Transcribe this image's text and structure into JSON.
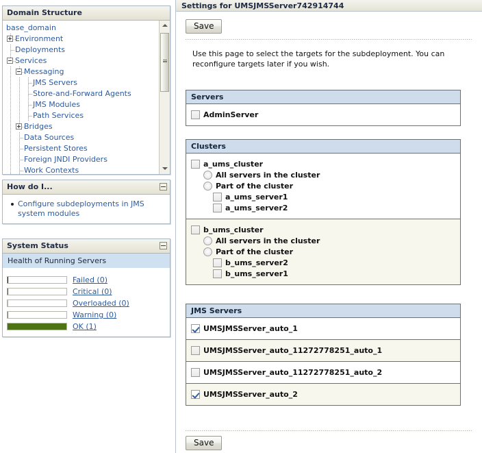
{
  "left": {
    "domain_structure": {
      "title": "Domain Structure",
      "root": "base_domain",
      "nodes": [
        {
          "label": "Environment",
          "toggle": "plus"
        },
        {
          "label": "Deployments",
          "toggle": "none"
        },
        {
          "label": "Services",
          "toggle": "minus"
        },
        {
          "label": "Messaging",
          "toggle": "minus"
        },
        {
          "label": "JMS Servers",
          "toggle": "none"
        },
        {
          "label": "Store-and-Forward Agents",
          "toggle": "none"
        },
        {
          "label": "JMS Modules",
          "toggle": "none"
        },
        {
          "label": "Path Services",
          "toggle": "none"
        },
        {
          "label": "Bridges",
          "toggle": "plus"
        },
        {
          "label": "Data Sources",
          "toggle": "none"
        },
        {
          "label": "Persistent Stores",
          "toggle": "none"
        },
        {
          "label": "Foreign JNDI Providers",
          "toggle": "none"
        },
        {
          "label": "Work Contexts",
          "toggle": "none"
        }
      ]
    },
    "how_do_i": {
      "title": "How do I...",
      "links": [
        "Configure subdeployments in JMS system modules"
      ]
    },
    "system_status": {
      "title": "System Status",
      "subheader": "Health of Running Servers",
      "rows": [
        {
          "label": "Failed (0)",
          "color": "#111111",
          "fill_pct": 1
        },
        {
          "label": "Critical (0)",
          "color": "#e01b1b",
          "fill_pct": 1
        },
        {
          "label": "Overloaded (0)",
          "color": "#f0b323",
          "fill_pct": 1
        },
        {
          "label": "Warning (0)",
          "color": "#3f8f99",
          "fill_pct": 1
        },
        {
          "label": "OK (1)",
          "color": "#4c7314",
          "fill_pct": 100
        }
      ]
    }
  },
  "right": {
    "title": "Settings for UMSJMSServer742914744",
    "save_top_label": "Save",
    "save_bottom_label": "Save",
    "intro": "Use this page to select the targets for the subdeployment. You can reconfigure targets later if you wish.",
    "sections": {
      "servers": {
        "header": "Servers",
        "items": [
          {
            "label": "AdminServer",
            "checked": false
          }
        ]
      },
      "clusters": {
        "header": "Clusters",
        "groups": [
          {
            "name": "a_ums_cluster",
            "checked": false,
            "all_servers_label": "All servers in the cluster",
            "all_servers_selected": false,
            "part_of_label": "Part of the cluster",
            "part_of_selected": false,
            "members": [
              {
                "label": "a_ums_server1",
                "checked": false
              },
              {
                "label": "a_ums_server2",
                "checked": false
              }
            ]
          },
          {
            "name": "b_ums_cluster",
            "checked": false,
            "all_servers_label": "All servers in the cluster",
            "all_servers_selected": false,
            "part_of_label": "Part of the cluster",
            "part_of_selected": false,
            "members": [
              {
                "label": "b_ums_server2",
                "checked": false
              },
              {
                "label": "b_ums_server1",
                "checked": false
              }
            ]
          }
        ]
      },
      "jms_servers": {
        "header": "JMS Servers",
        "items": [
          {
            "label": "UMSJMSServer_auto_1",
            "checked": true
          },
          {
            "label": "UMSJMSServer_auto_11272778251_auto_1",
            "checked": false
          },
          {
            "label": "UMSJMSServer_auto_11272778251_auto_2",
            "checked": false
          },
          {
            "label": "UMSJMSServer_auto_2",
            "checked": true
          }
        ]
      }
    }
  },
  "colors": {
    "panel_header_text": "#1f2a44",
    "section_header_bg": "#cfdcec",
    "link": "#2e5a9c",
    "health_subheader_bg": "#cfe0f0"
  }
}
